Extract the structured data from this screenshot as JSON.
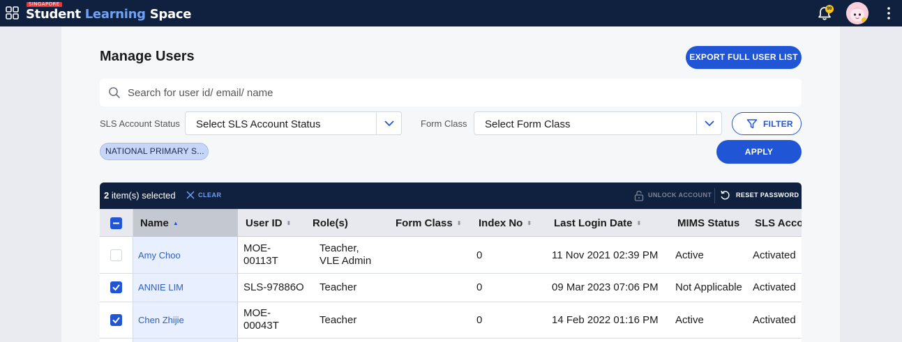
{
  "header": {
    "logo_tag": "SINGAPORE",
    "logo_student": "Student",
    "logo_learning": "Learning",
    "logo_space": "Space",
    "notification_count": "99"
  },
  "page": {
    "title": "Manage Users",
    "export_label": "EXPORT FULL USER LIST",
    "search_placeholder": "Search for user id/ email/ name"
  },
  "filters": {
    "status_label": "SLS Account Status",
    "status_value": "Select SLS Account Status",
    "form_class_label": "Form Class",
    "form_class_value": "Select Form Class",
    "filter_label": "FILTER",
    "apply_label": "APPLY",
    "school_chip": "NATIONAL PRIMARY S..."
  },
  "selection_bar": {
    "count": "2",
    "selected_text": "item(s) selected",
    "clear_label": "CLEAR",
    "unlock_label": "UNLOCK ACCOUNT",
    "reset_label": "RESET PASSWORD"
  },
  "table": {
    "columns": [
      "Name",
      "User ID",
      "Role(s)",
      "Form Class",
      "Index No",
      "Last Login Date",
      "MIMS Status",
      "SLS Accou"
    ],
    "rows": [
      {
        "checked": false,
        "name": "Amy Choo",
        "user_id_1": "MOE-",
        "user_id_2": "00113T",
        "role_1": "Teacher,",
        "role_2": "VLE Admin",
        "form_class": "",
        "index_no": "0",
        "last_login": "11 Nov 2021 02:39 PM",
        "mims_status": "Active",
        "sls_status": "Activated"
      },
      {
        "checked": true,
        "name": "ANNIE LIM",
        "user_id_1": "SLS-97886O",
        "user_id_2": "",
        "role_1": "Teacher",
        "role_2": "",
        "form_class": "",
        "index_no": "0",
        "last_login": "09 Mar 2023 07:06 PM",
        "mims_status": "Not Applicable",
        "sls_status": "Activated"
      },
      {
        "checked": true,
        "name": "Chen Zhijie",
        "user_id_1": "MOE-",
        "user_id_2": "00043T",
        "role_1": "Teacher",
        "role_2": "",
        "form_class": "",
        "index_no": "0",
        "last_login": "14 Feb 2022 01:16 PM",
        "mims_status": "Active",
        "sls_status": "Activated"
      }
    ]
  },
  "colors": {
    "navbar": "#10213f",
    "primary": "#2055d6",
    "link": "#2f5fc4"
  }
}
